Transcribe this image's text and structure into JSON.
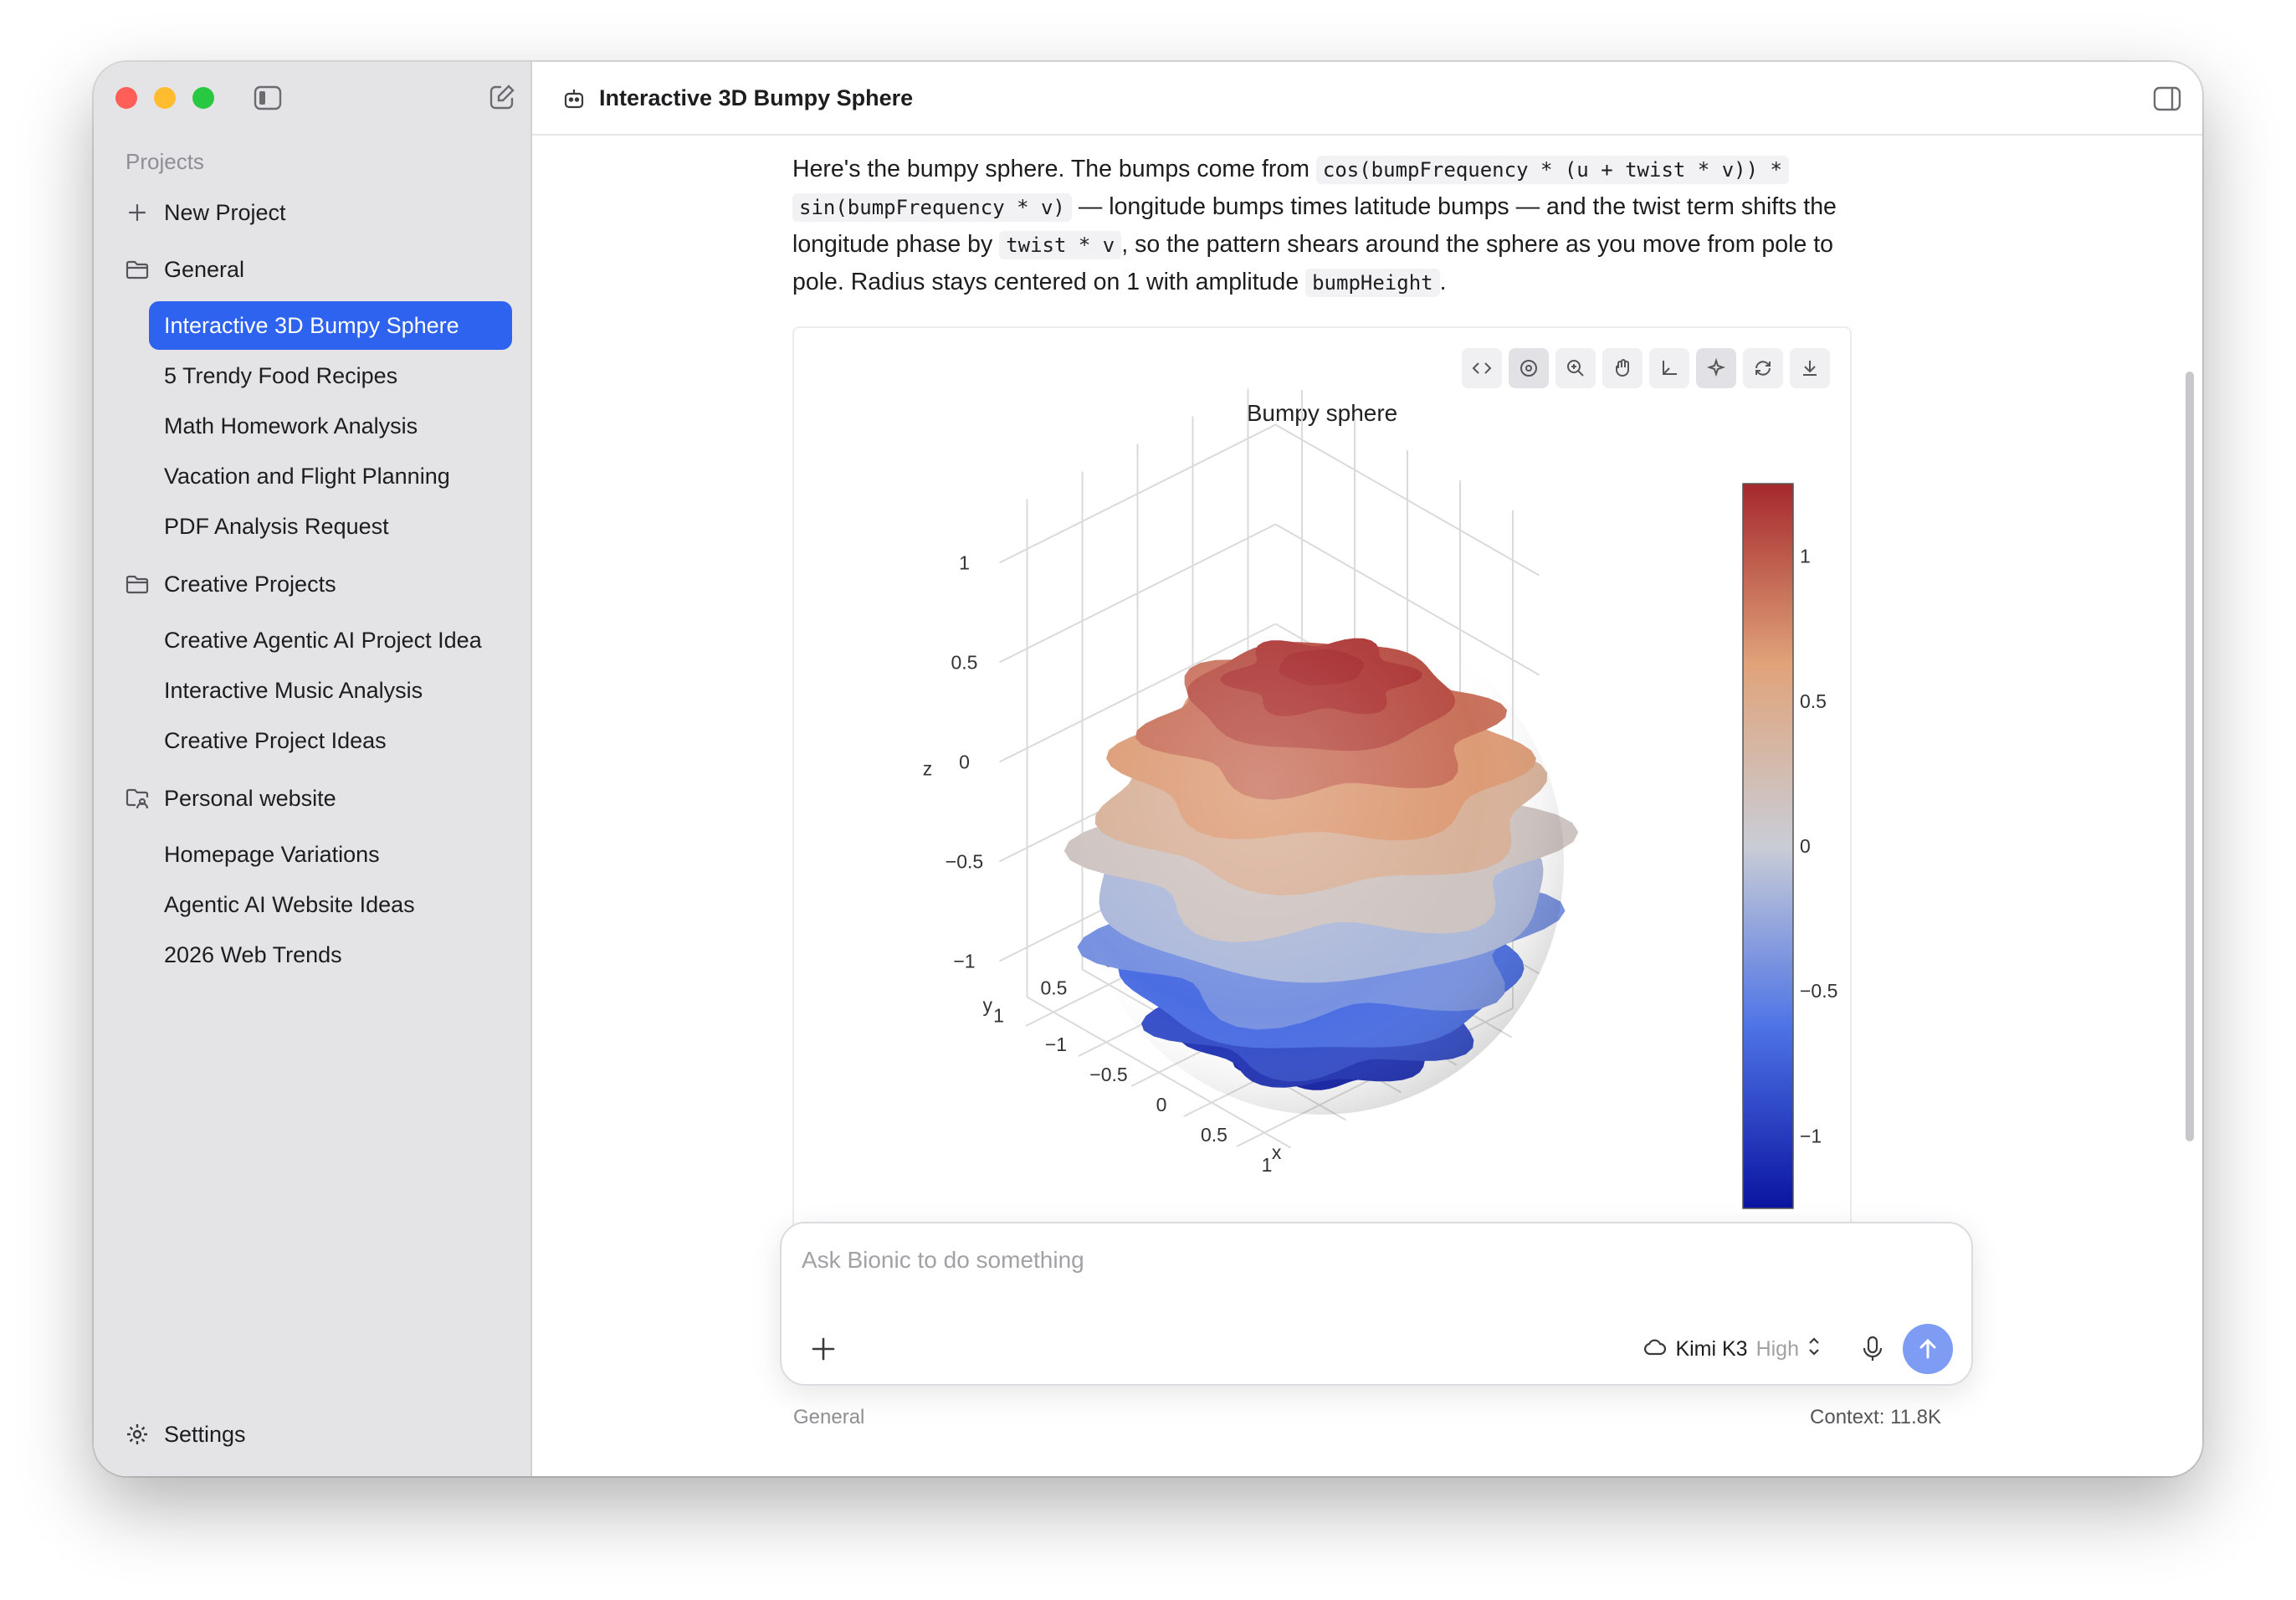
{
  "sidebar": {
    "projects_label": "Projects",
    "new_project": "New Project",
    "groups": [
      {
        "name": "General",
        "chats": [
          "Interactive 3D Bumpy Sphere",
          "5 Trendy Food Recipes",
          "Math Homework Analysis",
          "Vacation and Flight Planning",
          "PDF Analysis Request"
        ]
      },
      {
        "name": "Creative Projects",
        "chats": [
          "Creative Agentic AI Project Idea",
          "Interactive Music Analysis",
          "Creative Project Ideas"
        ]
      },
      {
        "name": "Personal website",
        "chats": [
          "Homepage Variations",
          "Agentic AI Website Ideas",
          "2026 Web Trends"
        ]
      }
    ],
    "active_chat": "Interactive 3D Bumpy Sphere",
    "settings": "Settings"
  },
  "header": {
    "title": "Interactive 3D Bumpy Sphere"
  },
  "message": {
    "p1": "Here's the bumpy sphere. The bumps come from",
    "code1": "cos(bumpFrequency * (u + twist * v)) *",
    "code2": "sin(bumpFrequency * v)",
    "p2": "— longitude bumps times latitude bumps — and the twist term shifts the longitude phase by",
    "code3": "twist * v",
    "p3": ", so the pattern shears around the sphere as you move from pole to pole. Radius stays centered on 1 with amplitude",
    "code4": "bumpHeight",
    "p4": "."
  },
  "chart_data": {
    "type": "surface3d",
    "title": "Bumpy sphere",
    "axes": {
      "x": {
        "label": "x",
        "ticks": [
          "−1",
          "−0.5",
          "0",
          "0.5",
          "1"
        ]
      },
      "y": {
        "label": "y",
        "ticks": [
          "−1",
          "−0.5",
          "0",
          "0.5",
          "1"
        ]
      },
      "z": {
        "label": "z",
        "ticks": [
          "−1",
          "−0.5",
          "0",
          "0.5",
          "1"
        ]
      }
    },
    "colorbar": {
      "ticks": [
        "1",
        "0.5",
        "0",
        "−0.5",
        "−1"
      ],
      "range": [
        -1.25,
        1.25
      ],
      "colorscale": [
        "#0a14a0",
        "#4e73e6",
        "#c9cdd6",
        "#e0a37a",
        "#a5282c"
      ]
    },
    "grid": true
  },
  "toolbar": [
    "code-icon",
    "rotate-icon",
    "zoom-icon",
    "pan-icon",
    "axes-icon",
    "sparkle-icon",
    "reset-icon",
    "download-icon"
  ],
  "composer": {
    "placeholder": "Ask Bionic to do something",
    "model": "Kimi K3",
    "effort": "High"
  },
  "footer": {
    "project": "General",
    "context": "Context: 11.8K"
  }
}
